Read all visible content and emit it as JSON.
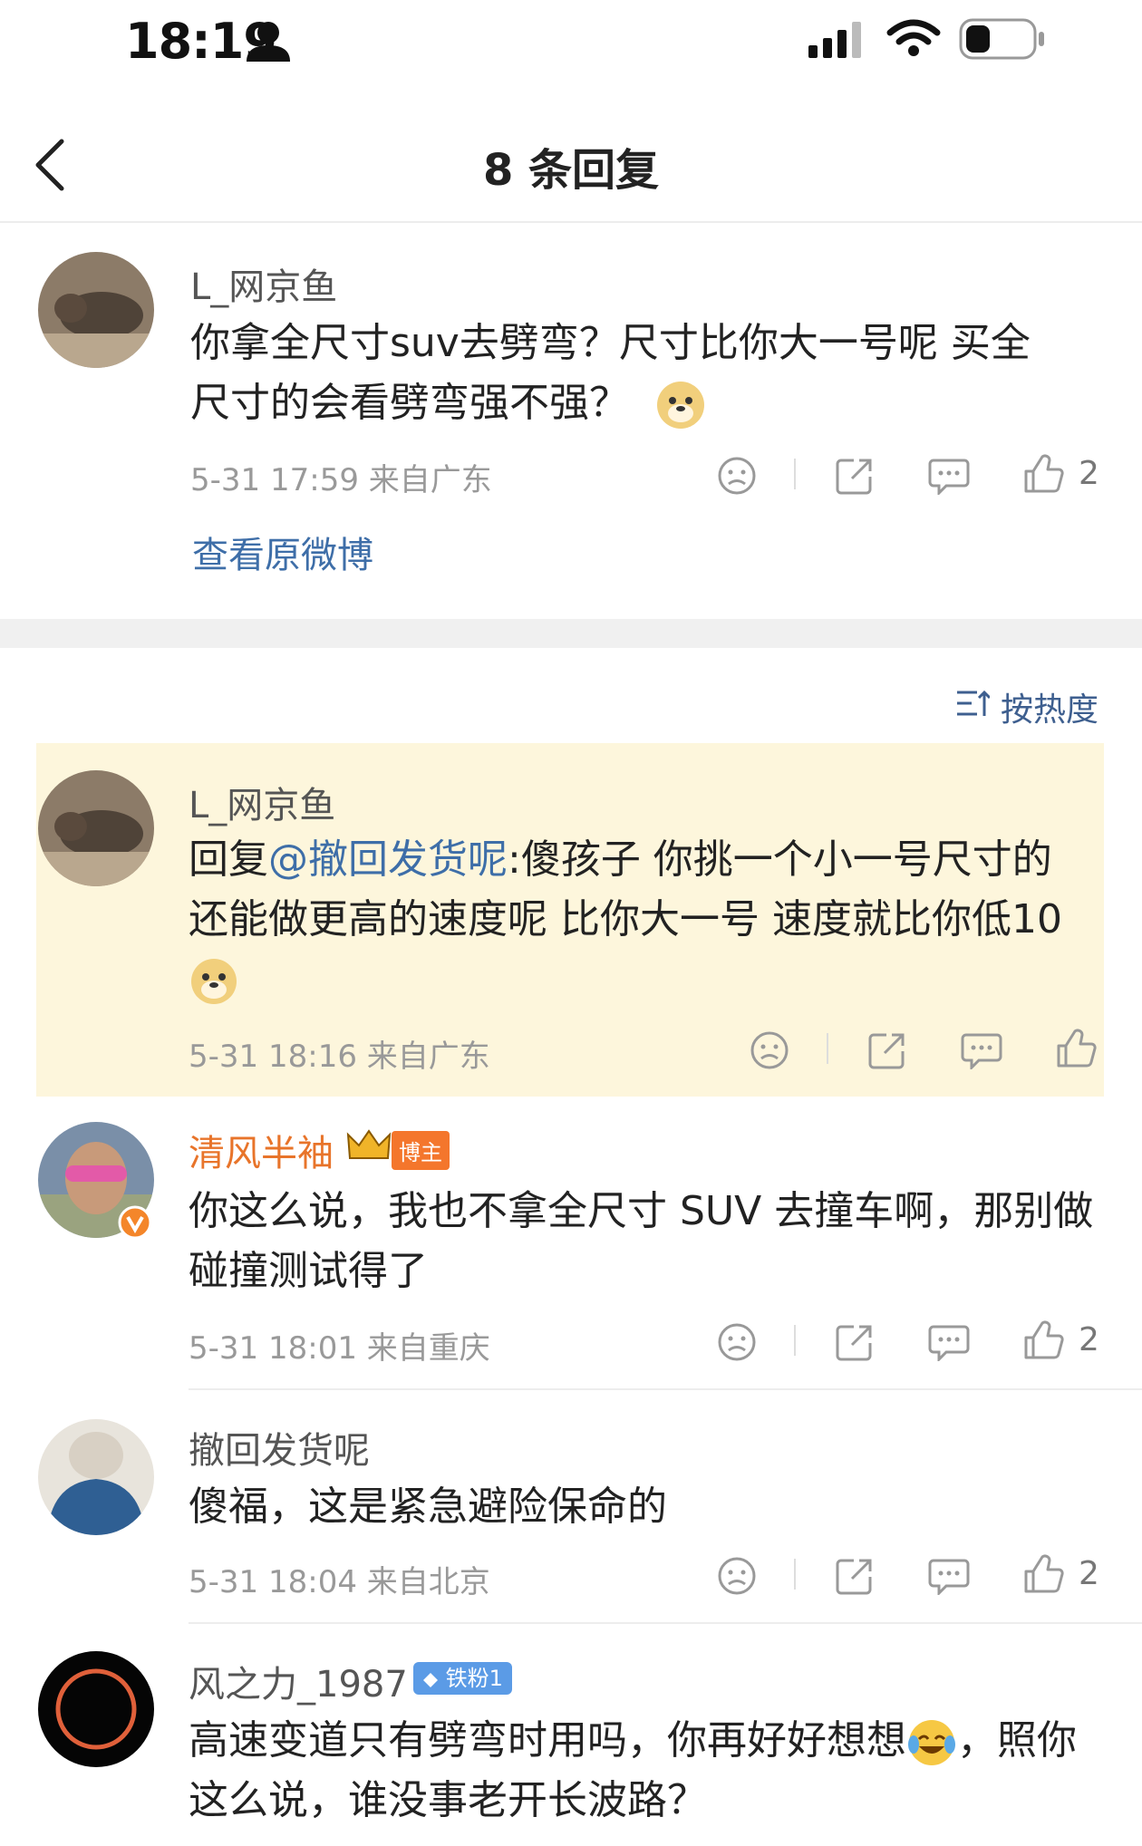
{
  "status_bar": {
    "time": "18:19"
  },
  "header": {
    "title": "8 条回复"
  },
  "main_comment": {
    "username": "L_网京鱼",
    "text_line1": "你拿全尺寸suv去劈弯？尺寸比你大一号呢  买全",
    "text_line2": "尺寸的会看劈弯强不强？",
    "timestamp": "5-31 17:59  来自广东",
    "like_count": "2",
    "view_original_label": "查看原微博"
  },
  "sort_label": "按热度",
  "replies": [
    {
      "username": "L_网京鱼",
      "reply_prefix": "回复",
      "mention": "@撤回发货呢",
      "text_line1": ":傻孩子 你挑一个小一号尺寸的",
      "text_line2": "还能做更高的速度呢 比你大一号 速度就比你低10",
      "timestamp": "5-31 18:16  来自广东",
      "like_count": ""
    },
    {
      "username": "清风半袖",
      "badge": "博主",
      "text_line1": "你这么说，我也不拿全尺寸 SUV 去撞车啊，那别做",
      "text_line2": "碰撞测试得了",
      "timestamp": "5-31 18:01  来自重庆",
      "like_count": "2"
    },
    {
      "username": "撤回发货呢",
      "text_line1": "傻福，这是紧急避险保命的",
      "timestamp": "5-31 18:04  来自北京",
      "like_count": "2"
    },
    {
      "username": "风之力_1987",
      "badge": "铁粉1",
      "text_line1a": "高速变道只有劈弯时用吗，你再好好想想",
      "text_line1b": "，照你",
      "text_line2": "这么说，谁没事老开长波路？"
    }
  ],
  "colors": {
    "link": "#3e6ea8",
    "highlight": "#fdf6dc",
    "vip_name": "#e8742a"
  },
  "icons": [
    "back-icon",
    "signal-icon",
    "wifi-icon",
    "battery-icon",
    "person-icon",
    "dislike-icon",
    "share-icon",
    "comment-icon",
    "like-icon",
    "sort-icon",
    "doge-emoji",
    "laugh-cry-emoji",
    "crown-icon",
    "verified-icon",
    "diamond-icon"
  ]
}
